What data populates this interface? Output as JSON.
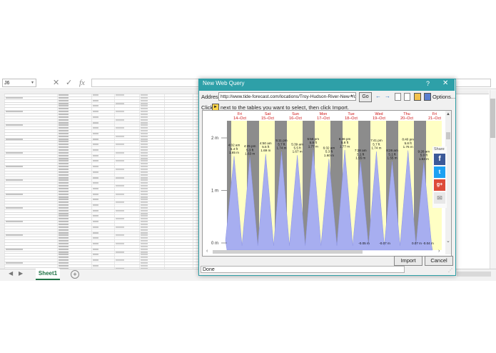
{
  "excel": {
    "name_box": "J6",
    "formula_icons": [
      "cancel-icon",
      "check-icon",
      "function-icon"
    ],
    "fx_label": "fx",
    "sheet_tab": "Sheet1",
    "add_sheet": "+",
    "nav_prev": "◀",
    "nav_next": "▶"
  },
  "dialog": {
    "title": "New Web Query",
    "help": "?",
    "close": "✕",
    "address_label": "Address:",
    "address_value": "http://www.tide-forecast.com/locations/Troy-Hudson-River-New-York/",
    "go": "Go",
    "options": "Options...",
    "instruction_click": "Click",
    "instruction_text": "next to the tables you want to select, then click Import.",
    "status": "Done",
    "import": "Import",
    "cancel": "Cancel",
    "share": "Share"
  },
  "colors": {
    "titlebar": "#2ea0a8",
    "night": "#8c8c8c",
    "day": "#ffffc4",
    "tide": "#a7aef0",
    "day_label": "#cc1111",
    "excel_green": "#217346"
  },
  "chart_data": {
    "type": "area",
    "title": "",
    "days": [
      {
        "name": "Fri",
        "date": "14–Oct"
      },
      {
        "name": "Sat",
        "date": "15–Oct"
      },
      {
        "name": "Sun",
        "date": "16–Oct"
      },
      {
        "name": "Mon",
        "date": "17–Oct"
      },
      {
        "name": "Tue",
        "date": "18–Oct"
      },
      {
        "name": "Wed",
        "date": "19–Oct"
      },
      {
        "name": "Thu",
        "date": "20–Oct"
      },
      {
        "name": "Fri",
        "date": "21–Oct"
      }
    ],
    "y_ticks": [
      "2 m",
      "1 m",
      "0 m"
    ],
    "ylim": [
      0,
      2.3
    ],
    "high_tides": [
      {
        "time": "4:02 am",
        "ft": "5.4 ft",
        "m": "1.65 m",
        "value": 1.65
      },
      {
        "time": "4:25 pm",
        "ft": "5.3 ft",
        "m": "1.63 m",
        "value": 1.63
      },
      {
        "time": "4:50 am",
        "ft": "5.5 ft",
        "m": "1.69 m",
        "value": 1.69
      },
      {
        "time": "5:11 pm",
        "ft": "5.7 ft",
        "m": "1.74 m",
        "value": 1.74
      },
      {
        "time": "5:39 am",
        "ft": "5.5 ft",
        "m": "1.67 m",
        "value": 1.67
      },
      {
        "time": "5:56 pm",
        "ft": "5.8 ft",
        "m": "1.77 m",
        "value": 1.77
      },
      {
        "time": "6:32 am",
        "ft": "5.3 ft",
        "m": "1.60 m",
        "value": 1.6
      },
      {
        "time": "6:46 pm",
        "ft": "5.8 ft",
        "m": "1.77 m",
        "value": 1.77
      },
      {
        "time": "7:28 am",
        "ft": "5.1 ft",
        "m": "1.55 m",
        "value": 1.55
      },
      {
        "time": "7:41 pm",
        "ft": "5.7 ft",
        "m": "1.74 m",
        "value": 1.74
      },
      {
        "time": "8:26 am",
        "ft": "5.1 ft",
        "m": "1.55 m",
        "value": 1.55
      },
      {
        "time": "8:40 pm",
        "ft": "5.8 ft",
        "m": "1.76 m",
        "value": 1.76
      },
      {
        "time": "9:26 am",
        "ft": "5.0 ft",
        "m": "1.53 m",
        "value": 1.53
      }
    ],
    "low_tides": [
      {
        "label": "-0.05 m",
        "value": -0.05
      },
      {
        "label": "-0.07 m",
        "value": -0.07
      },
      {
        "label": "0.07 m",
        "value": 0.07
      },
      {
        "label": "-0.04 m",
        "value": -0.04
      }
    ]
  }
}
